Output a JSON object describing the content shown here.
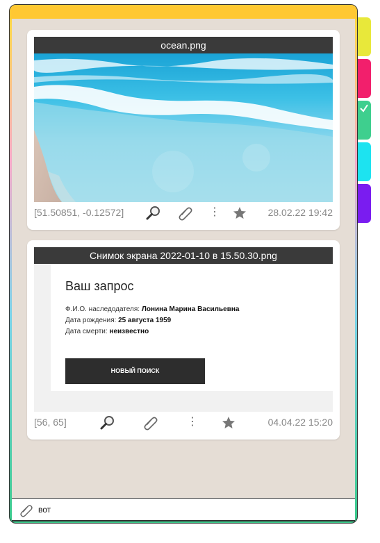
{
  "colors": {
    "top_bar": "#ffc832",
    "tabs": [
      "#e8e83a",
      "#f21f6c",
      "#3ecf8e",
      "#1de3f0",
      "#7a1cf0"
    ]
  },
  "tabs": [
    {
      "color": "yellow",
      "checked": false
    },
    {
      "color": "pink",
      "checked": false
    },
    {
      "color": "green",
      "checked": true
    },
    {
      "color": "cyan",
      "checked": false
    },
    {
      "color": "purple",
      "checked": false
    }
  ],
  "messages": [
    {
      "file_name": "ocean.png",
      "image_kind": "ocean-photo",
      "coords": "[51.50851, -0.12572]",
      "date": "28.02.22 19:42",
      "icons": [
        "magnifier-icon",
        "paperclip-icon",
        "more-icon",
        "star-icon"
      ],
      "more_glyph": "⋮"
    },
    {
      "file_name": "Снимок экрана 2022-01-10 в 15.50.30.png",
      "image_kind": "screenshot",
      "coords": "[56, 65]",
      "date": "04.04.22 15:20",
      "more_glyph": "⋮",
      "screenshot": {
        "heading": "Ваш запрос",
        "lines": [
          {
            "label": "Ф.И.О. наследодателя: ",
            "value": "Лонина Марина Васильевна"
          },
          {
            "label": "Дата рождения: ",
            "value": "25 августа 1959"
          },
          {
            "label": "Дата смерти: ",
            "value": "неизвестно"
          }
        ],
        "button": "НОВЫЙ ПОИСК"
      }
    }
  ],
  "composer": {
    "text": "вот",
    "icon": "paperclip-icon"
  }
}
